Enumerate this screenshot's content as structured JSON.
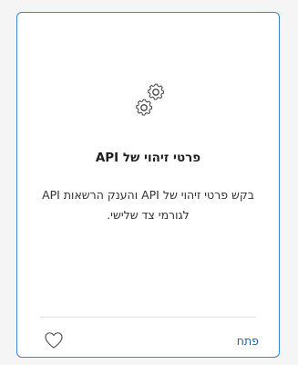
{
  "card": {
    "icon": "gears-icon",
    "title": "פרטי זיהוי של API",
    "description": "בקש פרטי זיהוי של API והענק הרשאות API לגורמי צד שלישי.",
    "open_label": "פתח",
    "favorite_icon": "heart-outline-icon"
  },
  "colors": {
    "card_border": "#3a87d0",
    "link": "#1a62b4",
    "title": "#1f1f1f",
    "text": "#323130",
    "icon_stroke": "#444444"
  }
}
